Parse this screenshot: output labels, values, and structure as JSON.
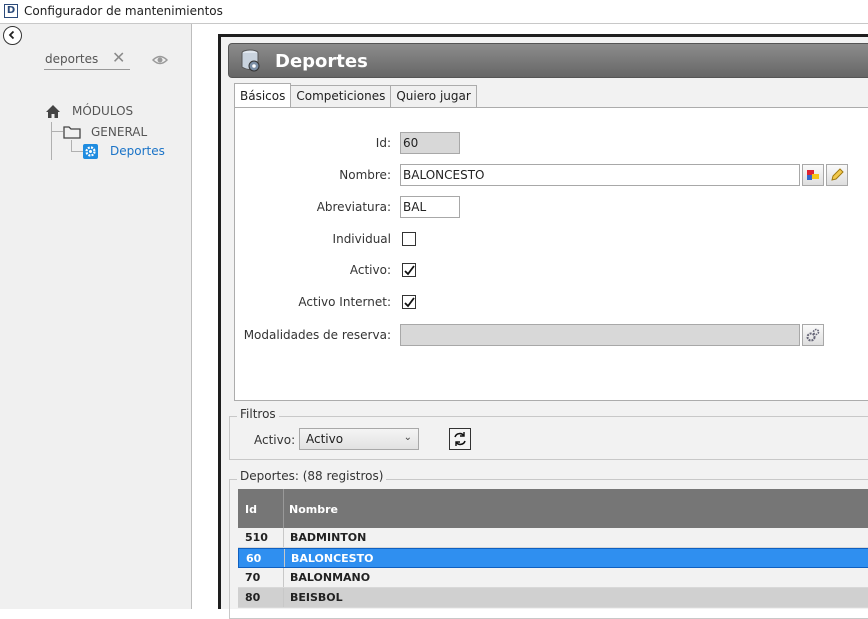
{
  "window": {
    "title": "Configurador de mantenimientos",
    "app_icon_letter": "D"
  },
  "sidebar": {
    "search": {
      "value": "deportes"
    },
    "tree": {
      "root": {
        "label": "MÓDULOS",
        "icon": "home-icon"
      },
      "group": {
        "label": "GENERAL",
        "icon": "folder-icon"
      },
      "item": {
        "label": "Deportes",
        "icon": "gear-icon"
      }
    }
  },
  "header": {
    "title": "Deportes",
    "icon": "database-gear-icon"
  },
  "tabs": [
    {
      "label": "Básicos",
      "active": true
    },
    {
      "label": "Competiciones",
      "active": false
    },
    {
      "label": "Quiero jugar",
      "active": false
    }
  ],
  "form": {
    "id": {
      "label": "Id:",
      "value": "60"
    },
    "nombre": {
      "label": "Nombre:",
      "value": "BALONCESTO"
    },
    "abreviatura": {
      "label": "Abreviatura:",
      "value": "BAL"
    },
    "individual": {
      "label": "Individual",
      "checked": false
    },
    "activo": {
      "label": "Activo:",
      "checked": true
    },
    "activo_internet": {
      "label": "Activo Internet:",
      "checked": true
    },
    "modalidades": {
      "label": "Modalidades de reserva:",
      "value": ""
    }
  },
  "filters": {
    "title": "Filtros",
    "activo_label": "Activo:",
    "activo_value": "Activo"
  },
  "list": {
    "title": "Deportes:",
    "count": "(88 registros)",
    "columns": {
      "id": "Id",
      "name": "Nombre"
    },
    "rows": [
      {
        "id": "510",
        "name": "BADMINTON",
        "selected": false
      },
      {
        "id": "60",
        "name": "BALONCESTO",
        "selected": true
      },
      {
        "id": "70",
        "name": "BALONMANO",
        "selected": false
      },
      {
        "id": "80",
        "name": "BEISBOL",
        "selected": false
      }
    ]
  },
  "colors": {
    "accent": "#2f8ff0",
    "tree_selected": "#1a73c7",
    "header_bg": "#767676"
  }
}
